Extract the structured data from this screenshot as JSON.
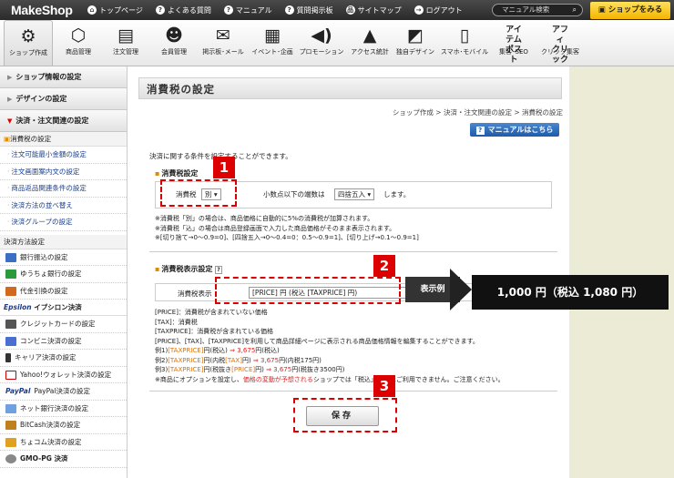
{
  "topbar": {
    "brand": "MakeShop",
    "links": [
      "トップページ",
      "よくある質問",
      "マニュアル",
      "質問掲示板",
      "サイトマップ",
      "ログアウト"
    ],
    "search_placeholder": "マニュアル検索",
    "shop_button": "ショップをみる"
  },
  "iconbar": [
    {
      "label": "ショップ作成",
      "icon": "gear-icon"
    },
    {
      "label": "商品管理",
      "icon": "box-icon"
    },
    {
      "label": "注文管理",
      "icon": "document-icon"
    },
    {
      "label": "会員管理",
      "icon": "people-icon"
    },
    {
      "label": "掲示板･メール",
      "icon": "mail-icon"
    },
    {
      "label": "イベント･企画",
      "icon": "calendar-icon"
    },
    {
      "label": "プロモーション",
      "icon": "megaphone-icon"
    },
    {
      "label": "アクセス統計",
      "icon": "chart-icon"
    },
    {
      "label": "独自デザイン",
      "icon": "design-icon"
    },
    {
      "label": "スマホ･モバイル",
      "icon": "mobile-icon"
    },
    {
      "label": "集客･SEO",
      "icon": "item-post-icon"
    },
    {
      "label": "クリック集客",
      "icon": "affiliate-icon"
    }
  ],
  "sidebar": {
    "sections": [
      "ショップ情報の設定",
      "デザインの設定",
      "決済・注文関連の設定"
    ],
    "group1": "消費税の設定",
    "items": [
      "注文可能最小金額の設定",
      "注文画面案内文の設定",
      "商品返品関連条件の設定",
      "決済方法の並べ替え",
      "決済グループの設定"
    ],
    "group2": "決済方法設定",
    "payments": [
      "銀行振込の設定",
      "ゆうちょ銀行の設定",
      "代金引換の設定"
    ],
    "epsilon": "イプシロン決済",
    "epsilon_logo": "Epsilon",
    "epsilon_items": [
      "クレジットカードの設定",
      "コンビニ決済の設定",
      "キャリア決済の設定",
      "Yahoo!ウォレット決済の設定",
      "PayPal決済の設定",
      "ネット銀行決済の設定",
      "BitCash決済の設定",
      "ちょコム決済の設定"
    ],
    "paypal_logo": "PayPal",
    "gmo": "GMO-PG 決済"
  },
  "main": {
    "title": "消費税の設定",
    "breadcrumb": "ショップ作成 > 決済・注文関連の設定 > 消費税の設定",
    "manual_button": "マニュアルはこちら",
    "intro": "決済に関する条件を設定することができます。",
    "tax_setting": {
      "heading": "消費税設定",
      "tax_label": "消費税",
      "tax_value": "別",
      "rounding_label": "小数点以下の端数は",
      "rounding_value": "四捨五入",
      "rounding_suffix": "します。",
      "notes": [
        "※消費税「別」の場合は、商品価格に自動的に5%の消費税が加算されます。",
        "※消費税「込」の場合は商品登録画面で入力した商品価格がそのまま表示されます。",
        "※[切り捨て→0～0.9=0]、[四捨五入→0～0.4=0：0.5～0.9=1]、[切り上げ→0.1～0.9=1]"
      ]
    },
    "tax_display": {
      "heading": "消費税表示設定",
      "label": "消費税表示",
      "value": "[PRICE] 円 (税込 [TAXPRICE] 円)",
      "notes": [
        "[PRICE]：消費税が含まれていない価格",
        "[TAX]：消費税",
        "[TAXPRICE]：消費税が含まれている価格",
        "[PRICE]、[TAX]、[TAXPRICE]を利用して商品詳細ページに表示される商品価格情報を編集することができます。"
      ],
      "ex1_pre": "例1)",
      "ex1_tag": "[TAXPRICE]",
      "ex1_mid": "円(税込)",
      "ex1_res": "⇒ 3,675",
      "ex1_post": "円(税込)",
      "ex2_pre": "例2)",
      "ex2_tag1": "[TAXPRICE]",
      "ex2_mid1": "円(内税",
      "ex2_tag2": "[TAX]",
      "ex2_mid2": "円)",
      "ex2_res": "⇒ 3,675",
      "ex2_post": "円(内税175円)",
      "ex3_pre": "例3)",
      "ex3_tag1": "[TAXPRICE]",
      "ex3_mid": "円(税抜き",
      "ex3_tag2": "[PRICE]",
      "ex3_mid2": "円)",
      "ex3_res": "⇒ 3,675",
      "ex3_post": "円(税抜き3500円)",
      "warn_pre": "※商品にオプションを設定し、",
      "warn_red": "価格の変動が予想される",
      "warn_post": "ショップでは「税込」表記はご利用できません。ご注意ください。"
    },
    "save_button": "保存"
  },
  "annotations": {
    "badges": [
      "1",
      "2",
      "3"
    ],
    "example_label": "表示例",
    "example_value": "1,000 円（税込 1,080 円）"
  },
  "colors": {
    "accent_red": "#dd0000",
    "link_blue": "#1a3f8f",
    "highlight_orange": "#e07000"
  }
}
